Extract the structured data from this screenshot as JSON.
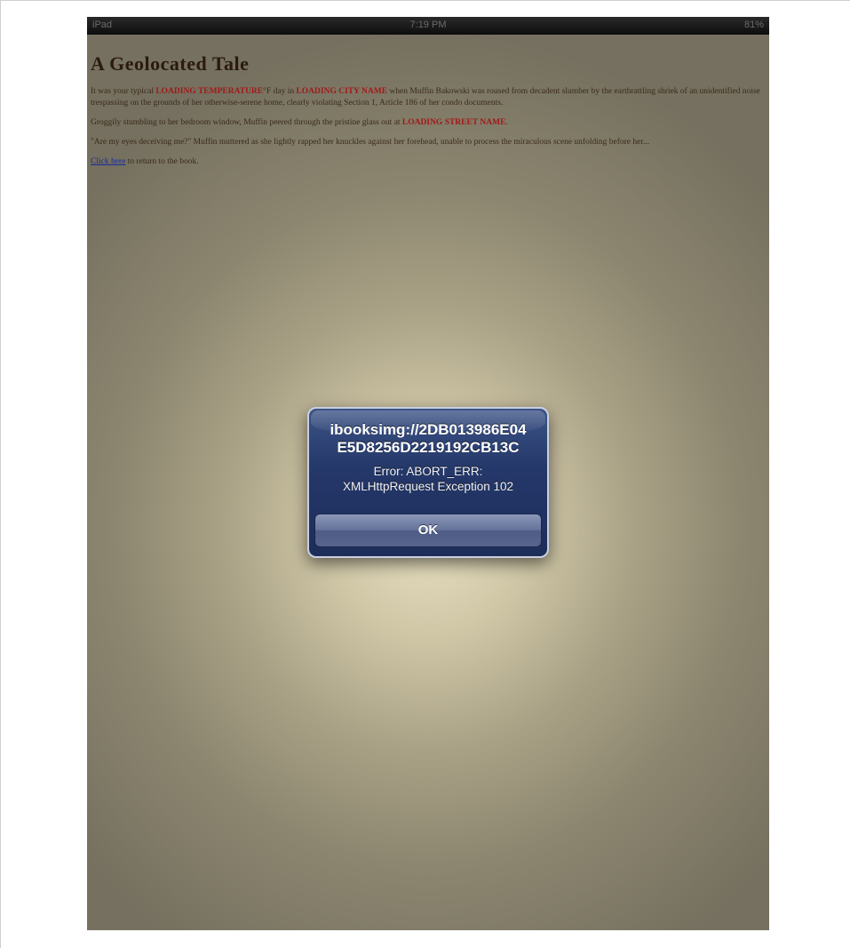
{
  "status_bar": {
    "left": "iPad",
    "time": "7:19 PM",
    "right": "81%"
  },
  "book": {
    "title": "A Geolocated Tale",
    "p1": {
      "before": "It was your typical ",
      "temp": "LOADING TEMPERATURE",
      "between": "°F day in ",
      "city": "LOADING CITY NAME",
      "after": " when Muffin Bakowski was roused from decadent slumber by the earthrattling shriek of an unidentified noise trespassing on the grounds of her otherwise-serene home, clearly violating Section 1, Article 186 of her condo documents."
    },
    "p2": {
      "before": "Groggily stumbling to her bedroom window, Muffin peered through the pristine glass out at ",
      "street": "LOADING STREET NAME",
      "after": "."
    },
    "p3": "\"Are my eyes deceiving me?\" Muffin muttered as she lightly rapped her knuckles against her forehead, unable to process the miraculous scene unfolding before her...",
    "p4": {
      "link": "Click here",
      "after": " to return to the book."
    }
  },
  "alert": {
    "title_line1": "ibooksimg://2DB013986E04",
    "title_line2": "E5D8256D2219192CB13C",
    "message_line1": "Error: ABORT_ERR:",
    "message_line2": "XMLHttpRequest Exception 102",
    "ok_label": "OK"
  }
}
